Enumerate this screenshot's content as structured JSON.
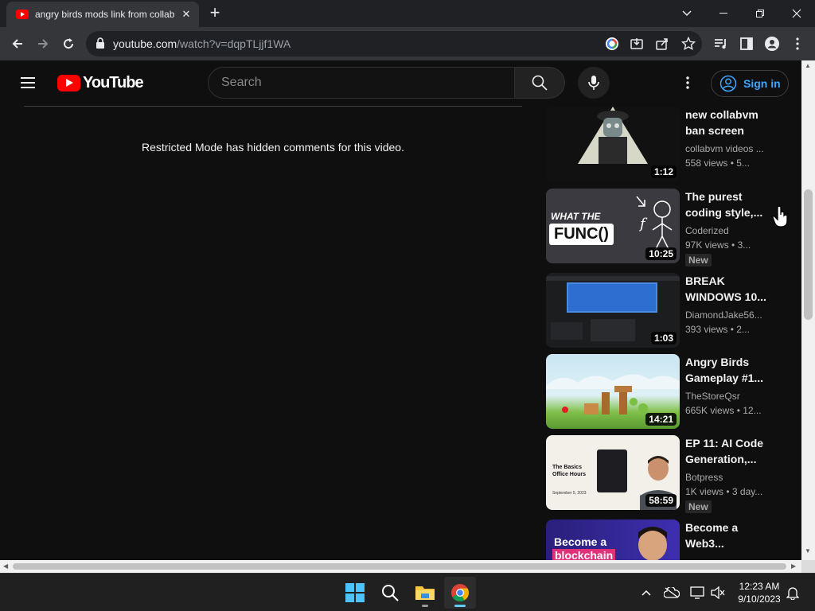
{
  "browser": {
    "tab_title": "angry birds mods link from collab",
    "tab_close": "✕",
    "new_tab": "+",
    "url_host": "youtube.com",
    "url_path": "/watch?v=dqpTLjjf1WA"
  },
  "youtube": {
    "logo_text": "YouTube",
    "search_placeholder": "Search",
    "sign_in": "Sign in",
    "restricted_message": "Restricted Mode has hidden comments for this video."
  },
  "videos": [
    {
      "title": "new collabvm ban screen",
      "channel": "collabvm videos ...",
      "views": "558 views",
      "age": "5...",
      "duration": "1:12",
      "badge": ""
    },
    {
      "title": "The purest coding style,...",
      "channel": "Coderized",
      "views": "97K views",
      "age": "3...",
      "duration": "10:25",
      "badge": "New",
      "thumb_text_1": "WHAT THE",
      "thumb_text_2": "FUNC()"
    },
    {
      "title": "BREAK WINDOWS 10...",
      "channel": "DiamondJake56...",
      "views": "393 views",
      "age": "2...",
      "duration": "1:03",
      "badge": ""
    },
    {
      "title": "Angry Birds Gameplay #1...",
      "channel": "TheStoreQsr",
      "views": "665K views",
      "age": "12...",
      "duration": "14:21",
      "badge": ""
    },
    {
      "title": "EP 11: AI Code Generation,...",
      "channel": "Botpress",
      "views": "1K views",
      "age": "3 day...",
      "duration": "58:59",
      "badge": "New",
      "thumb_text_1": "The Basics Office Hours",
      "thumb_text_2": "September 5, 2023"
    },
    {
      "title": "Become a Web3...",
      "channel": "",
      "views": "",
      "age": "",
      "duration": "",
      "badge": "",
      "thumb_text_1": "Become a",
      "thumb_text_2": "blockchain"
    }
  ],
  "taskbar": {
    "time": "12:23 AM",
    "date": "9/10/2023"
  },
  "colors": {
    "yt_bg": "#0f0f0f",
    "yt_red": "#ff0000",
    "link_blue": "#3ea6ff",
    "chrome_dark": "#202124",
    "chrome_toolbar": "#35363a"
  }
}
